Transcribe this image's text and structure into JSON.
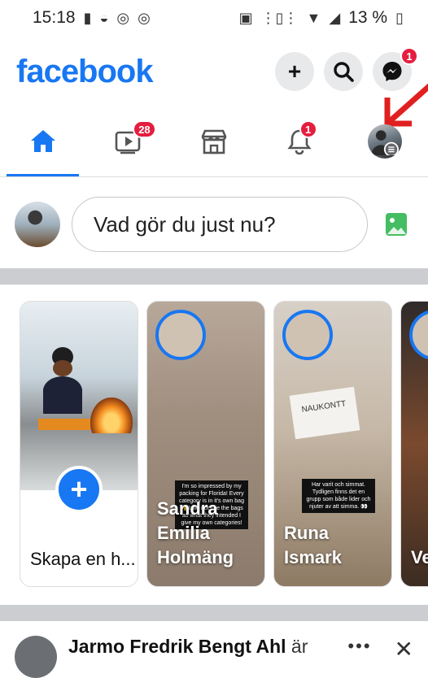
{
  "status_bar": {
    "time": "15:18",
    "battery": "13 %"
  },
  "header": {
    "logo": "facebook",
    "plus_icon": "plus-icon",
    "search_icon": "search-icon",
    "messenger_icon": "messenger-icon",
    "messenger_badge": "1"
  },
  "tabs": [
    {
      "name": "home",
      "icon": "home-icon",
      "active": true
    },
    {
      "name": "watch",
      "icon": "video-icon",
      "badge": "28"
    },
    {
      "name": "marketplace",
      "icon": "store-icon"
    },
    {
      "name": "notifications",
      "icon": "bell-icon",
      "badge": "1"
    },
    {
      "name": "menu",
      "icon": "profile-menu-icon"
    }
  ],
  "composer": {
    "placeholder": "Vad gör du just nu?"
  },
  "stories": {
    "create_label": "Skapa en h...",
    "items": [
      {
        "name": "Sandra Emilia Holmäng",
        "caption": "I'm so impressed by my packing for Florida! Every category is in it's own bag 🙌 I did not use the bags as what they intended I give my own categories!"
      },
      {
        "name": "Runa Ismark",
        "caption": "Har varit och simmat. Tydligen finns det en grupp som både lider och njuter av att simma. 👀"
      },
      {
        "name": "Ver Ber"
      }
    ],
    "card_note": "NAUKONTT"
  },
  "post": {
    "author": "Jarmo Fredrik Bengt Ahl",
    "suffix": " är",
    "more": "•••",
    "close": "✕"
  },
  "colors": {
    "brand": "#1877f2",
    "badge": "#e41e3f",
    "divider": "#cbcdd1"
  }
}
